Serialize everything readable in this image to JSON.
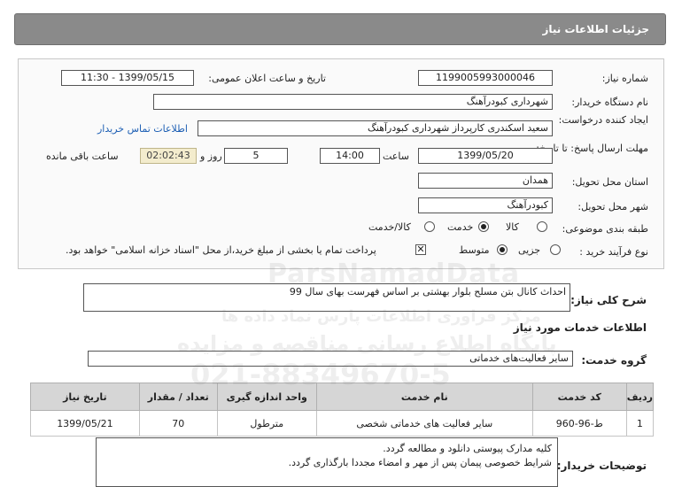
{
  "header": {
    "title": "جزئیات اطلاعات نیاز"
  },
  "fields": {
    "need_number_label": "شماره نیاز:",
    "need_number": "1199005993000046",
    "announce_label": "تاریخ و ساعت اعلان عمومی:",
    "announce_value": "1399/05/15 - 11:30",
    "buyer_org_label": "نام دستگاه خریدار:",
    "buyer_org": "شهرداری کبودرآهنگ",
    "requester_label": "ایجاد کننده درخواست:",
    "requester": "سعید اسکندری کارپرداز شهرداری کبودرآهنگ",
    "contact_link": "اطلاعات تماس خریدار",
    "deadline_label": "مهلت ارسال پاسخ: تا تاریخ:",
    "deadline_date": "1399/05/20",
    "time_label": "ساعت",
    "deadline_time": "14:00",
    "days_value": "5",
    "days_label": "روز و",
    "remaining_time": "02:02:43",
    "remaining_label": "ساعت باقی مانده",
    "province_label": "استان محل تحویل:",
    "province": "همدان",
    "city_label": "شهر محل تحویل:",
    "city": "کبودرآهنگ",
    "category_label": "طبقه بندی موضوعی:",
    "category_options": [
      "کالا",
      "خدمت",
      "کالا/خدمت"
    ],
    "category_selected": "خدمت",
    "process_label": "نوع فرآیند خرید :",
    "process_options": [
      "جزیی",
      "متوسط"
    ],
    "process_selected": "متوسط",
    "payment_note": "پرداخت تمام یا بخشی از مبلغ خرید،از محل \"اسناد خزانه اسلامی\" خواهد بود."
  },
  "description": {
    "label": "شرح کلی نیاز:",
    "text": "احداث کانال بتن مسلح بلوار بهشتی بر اساس فهرست بهای سال 99"
  },
  "services": {
    "section_title": "اطلاعات خدمات مورد نیاز",
    "group_label": "گروه خدمت:",
    "group_value": "سایر فعالیت‌های خدماتی",
    "columns": [
      "ردیف",
      "کد خدمت",
      "نام خدمت",
      "واحد اندازه گیری",
      "تعداد / مقدار",
      "تاریخ نیاز"
    ],
    "rows": [
      [
        "1",
        "ط-96-960",
        "سایر فعالیت های خدماتی شخصی",
        "مترطول",
        "70",
        "1399/05/21"
      ]
    ]
  },
  "buyer_notes": {
    "label": "توضیحات خریدار:",
    "line1": "کلیه مدارک پیوستی دانلود و مطالعه گردد.",
    "line2": "شرایط خصوصی پیمان پس از مهر و امضاء مجددا بارگذاری گردد."
  },
  "watermark": {
    "brand": "ParsNamadData",
    "line1": "مرکز فراوری اطلاعات پارس نماد داده ها",
    "line2": "پایگاه اطلاع رسانی مناقصه و مزایده",
    "phone": "021-88349670-5"
  }
}
